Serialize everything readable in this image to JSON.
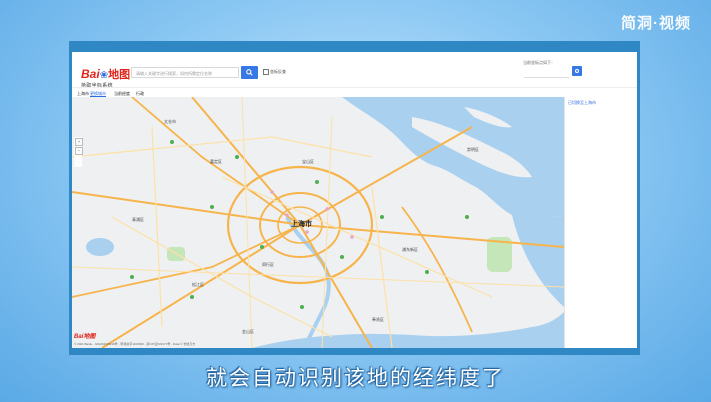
{
  "watermark": "简洞·视频",
  "app": {
    "logo_text": "Bai",
    "logo_paw": "❀",
    "logo_map": "地图",
    "logo_subtitle": "拾取坐标系统",
    "search_placeholder": "请输入关键字进行搜索，如何所需定位名称",
    "search_icon": "search-icon",
    "checkbox_label": "坐标反查",
    "coord_label": "当前坐标点如下：",
    "subbar": {
      "city": "上海市",
      "change_city": "更换城市",
      "link2": "当前经度",
      "link3": "行政"
    },
    "side_text": "已切换至上海市",
    "zoom_icons": [
      "plus-icon",
      "minus-icon"
    ],
    "map_corner_logo": "Bai地图",
    "copyright": "© 2021 Baidu - GS(2019)5218号 - 甲测资字1100930 - 京ICP证030173号 - Data © 长地万方"
  },
  "map": {
    "city_name": "上海市",
    "colors": {
      "water": "#a9d0ef",
      "land": "#eef0f2",
      "highway": "#f7b44b",
      "road": "#fde1a6",
      "park": "#c5e6b9"
    },
    "labels": [
      "太仓市",
      "嘉定区",
      "宝山区",
      "青浦区",
      "松江区",
      "闵行区",
      "浦东新区",
      "奉贤区",
      "金山区",
      "崇明区"
    ]
  },
  "caption": "就会自动识别该地的经纬度了"
}
